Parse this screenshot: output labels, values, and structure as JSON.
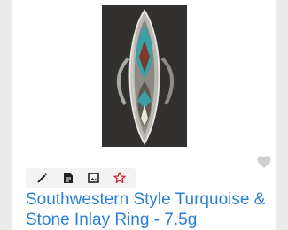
{
  "listing": {
    "title": "Southwestern Style Turquoise & Stone Inlay Ring - 7.5g",
    "image_alt": "Southwestern Style Turquoise & Stone Inlay Ring",
    "favorite_icon": "heart-icon",
    "favorite_color": "#cfcfcf",
    "link_color": "#2a7fd6"
  },
  "toolbar": {
    "tools": [
      {
        "icon": "pencil-icon",
        "color": "#222222"
      },
      {
        "icon": "document-icon",
        "color": "#222222"
      },
      {
        "icon": "image-icon",
        "color": "#222222"
      },
      {
        "icon": "star-icon",
        "color": "#cc1f2e"
      }
    ]
  }
}
